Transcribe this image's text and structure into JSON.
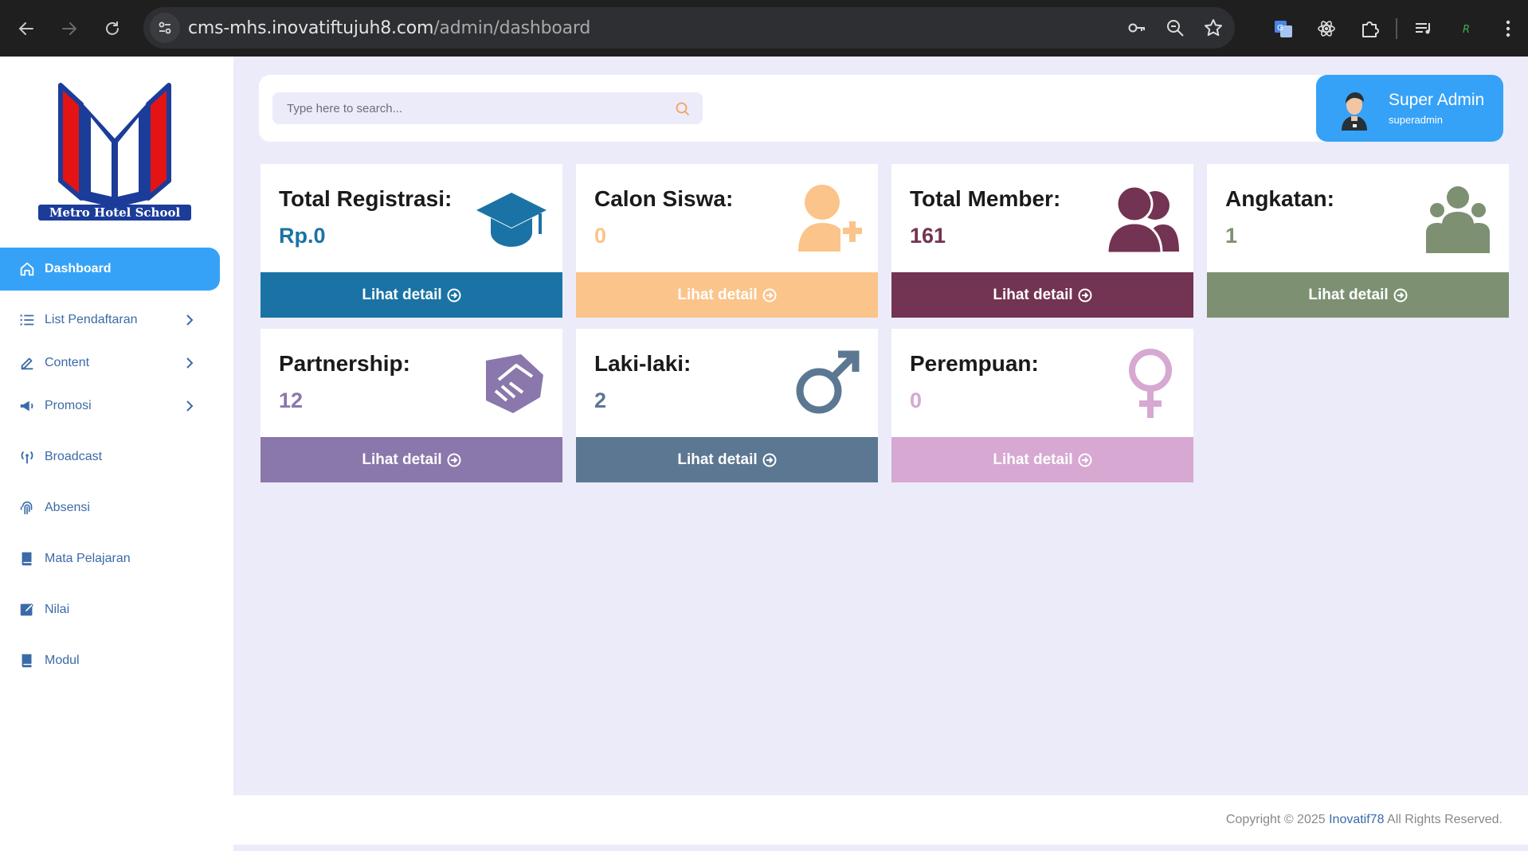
{
  "browser": {
    "url_host": "cms-mhs.inovatiftujuh8.com",
    "url_path": "/admin/dashboard"
  },
  "sidebar": {
    "logo_text": "Metro Hotel School",
    "items": [
      {
        "label": "Dashboard"
      },
      {
        "label": "List Pendaftaran"
      },
      {
        "label": "Content"
      },
      {
        "label": "Promosi"
      },
      {
        "label": "Broadcast"
      },
      {
        "label": "Absensi"
      },
      {
        "label": "Mata Pelajaran"
      },
      {
        "label": "Nilai"
      },
      {
        "label": "Modul"
      }
    ]
  },
  "search": {
    "placeholder": "Type here to search..."
  },
  "user": {
    "name": "Super Admin",
    "role": "superadmin"
  },
  "cards": [
    {
      "title": "Total Registrasi:",
      "value": "Rp.0",
      "footer": "Lihat detail",
      "color": "#1a73a4"
    },
    {
      "title": "Calon Siswa:",
      "value": "0",
      "footer": "Lihat detail",
      "color": "#fbc48a"
    },
    {
      "title": "Total Member:",
      "value": "161",
      "footer": "Lihat detail",
      "color": "#733352"
    },
    {
      "title": "Angkatan:",
      "value": "1",
      "footer": "Lihat detail",
      "color": "#7d9172"
    },
    {
      "title": "Partnership:",
      "value": "12",
      "footer": "Lihat detail",
      "color": "#8a77ab"
    },
    {
      "title": "Laki-laki:",
      "value": "2",
      "footer": "Lihat detail",
      "color": "#5c7792"
    },
    {
      "title": "Perempuan:",
      "value": "0",
      "footer": "Lihat detail",
      "color": "#d6a8d2"
    }
  ],
  "footer": {
    "prefix": "Copyright © 2025 ",
    "brand": "Inovatif78",
    "suffix": " All Rights Reserved."
  }
}
